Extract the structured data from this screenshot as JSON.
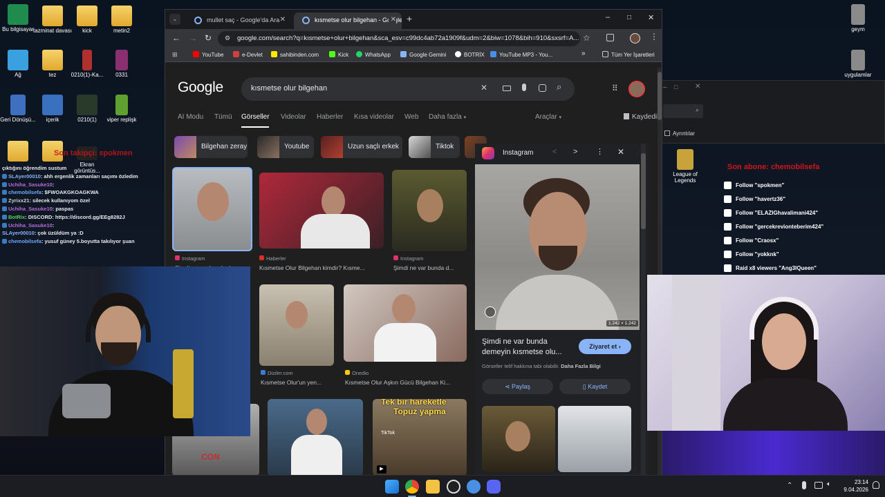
{
  "desktop": {
    "icons": [
      {
        "label": "Bu bilgisayar",
        "color": "#1f8b4c"
      },
      {
        "label": "tazminat davası",
        "color": "#e8b33a"
      },
      {
        "label": "kick",
        "color": "#e8b33a"
      },
      {
        "label": "metin2",
        "color": "#e8b33a"
      },
      {
        "label": "Ağ",
        "color": "#3aa0e0"
      },
      {
        "label": "tez",
        "color": "#e8b33a"
      },
      {
        "label": "0210(1)-Ka...",
        "color": "#b03030"
      },
      {
        "label": "0331",
        "color": "#8a3070"
      },
      {
        "label": "Geri Dönüşü...",
        "color": "#3f6fbf"
      },
      {
        "label": "içerik",
        "color": "#3a70c0"
      },
      {
        "label": "0210(1)",
        "color": "#2a3a2a"
      },
      {
        "label": "viper replişk",
        "color": "#60a030"
      },
      {
        "label": "Ekran görüntüs...",
        "color": "#e8b33a"
      },
      {
        "label": "geym",
        "color": "#8a8a8a"
      },
      {
        "label": "uygulamlar",
        "color": "#8a8a8a"
      },
      {
        "label": "League of Legends",
        "color": "#c8a23a"
      }
    ],
    "stream_overlay_left": "Son takipçi: spokmen",
    "stream_overlay_right": "Son abone: chemobilsefa",
    "partial_window": {
      "details_label": "Ayrıntılar"
    }
  },
  "browser": {
    "tabs": [
      {
        "title": "mullet saç - Google'da Ara",
        "active": false
      },
      {
        "title": "kısmetse olur bilgehan - Google",
        "active": true
      }
    ],
    "new_tab": "+",
    "address": "google.com/search?q=kısmetse+olur+bilgehan&sca_esv=c99dc4ab72a1909f&udm=2&biw=1078&bih=910&sxsrf=A...",
    "bookmarks": [
      {
        "label": "YouTube",
        "color": "#ff0000"
      },
      {
        "label": "e-Devlet",
        "color": "#d04040"
      },
      {
        "label": "sahibinden.com",
        "color": "#ffe800"
      },
      {
        "label": "Kick",
        "color": "#53fc18"
      },
      {
        "label": "WhatsApp",
        "color": "#25d366"
      },
      {
        "label": "Google Gemini",
        "color": "#8ab4f8"
      },
      {
        "label": "BOTRİX",
        "color": "#ffffff"
      },
      {
        "label": "YouTube MP3 - You...",
        "color": "#4a8fe7"
      }
    ],
    "bookmarks_more": "»",
    "all_bookmarks": "Tüm Yer İşaretleri"
  },
  "google": {
    "logo": "Google",
    "query": "kısmetse olur bilgehan",
    "nav": [
      "AI Modu",
      "Tümü",
      "Görseller",
      "Videolar",
      "Haberler",
      "Kısa videolar",
      "Web",
      "Daha fazla"
    ],
    "active_nav": "Görseller",
    "tools": "Araçlar",
    "saved": "Kaydedilenler",
    "chips": [
      "Bilgehan zeray",
      "Youtube",
      "Uzun saçlı erkek",
      "Tiktok"
    ],
    "results": [
      {
        "source": "Instagram",
        "title": "Şimdi ne var bunda d...",
        "src_color": "#e1306c"
      },
      {
        "source": "Haberler",
        "title": "Kısmetse Olur Bilgehan kimdir? Kısme...",
        "src_color": "#d93025"
      },
      {
        "source": "Instagram",
        "title": "Şimdi ne var bunda d...",
        "src_color": "#e1306c"
      },
      {
        "source": "Diziler.com",
        "title": "Kısmetse Olur'un yen...",
        "src_color": "#3a7bd5"
      },
      {
        "source": "Onedio",
        "title": "Kısmetse Olur Aşkın Gücü Bilgehan Ki...",
        "src_color": "#ffcc00"
      }
    ],
    "tiktok_overlay": [
      "Tek bir hareketle",
      "Topuz yapma"
    ],
    "tiktok_label": "TikTok",
    "side_panel": {
      "source": "Instagram",
      "dimensions": "1.242 × 1.242",
      "title": "Şimdi ne var bunda demeyin kısmetse olu...",
      "visit": "Ziyaret et",
      "copyright": "Görseller telif hakkına tabi olabilir.",
      "more_info": "Daha Fazla Bilgi",
      "share": "Paylaş",
      "save": "Kaydet"
    }
  },
  "chat": [
    {
      "user": "",
      "text": "çıktığını öğrendim sustum"
    },
    {
      "user": "SLAyer00010",
      "text": ": ahh ergenlik zamanları saçımı özledim"
    },
    {
      "user": "Uchiha_Sasuke10",
      "text": ":"
    },
    {
      "user": "chemobilsefa",
      "text": ": $FWOAKGKOAGKWA"
    },
    {
      "user": "Zyrixx21",
      "text": ": silecek kullanıyom özel"
    },
    {
      "user": "Uchiha_Sasuke10",
      "text": ": paspas"
    },
    {
      "user": "BotRix",
      "text": ": DISCORD: https://discord.gg/EEg8282J"
    },
    {
      "user": "Uchiha_Sasuke10",
      "text": ":"
    },
    {
      "user": "SLAyer00010",
      "text": ": çok üzüldüm ya :D"
    },
    {
      "user": "chemobilsefa",
      "text": ": yusuf güney 5.boyutta takılıyor şuan"
    }
  ],
  "follows": [
    "Follow \"spokmen\"",
    "Follow \"havertz36\"",
    "Follow \"ELAZIGhavalimani424\"",
    "Follow \"gercekrevionteberim424\"",
    "Follow \"Craosx\"",
    "Follow \"yokknk\"",
    "Raid x8 viewers \"Ang3lQueen\""
  ],
  "taskbar": {
    "time": "23:14",
    "date": "9.04.2026"
  }
}
